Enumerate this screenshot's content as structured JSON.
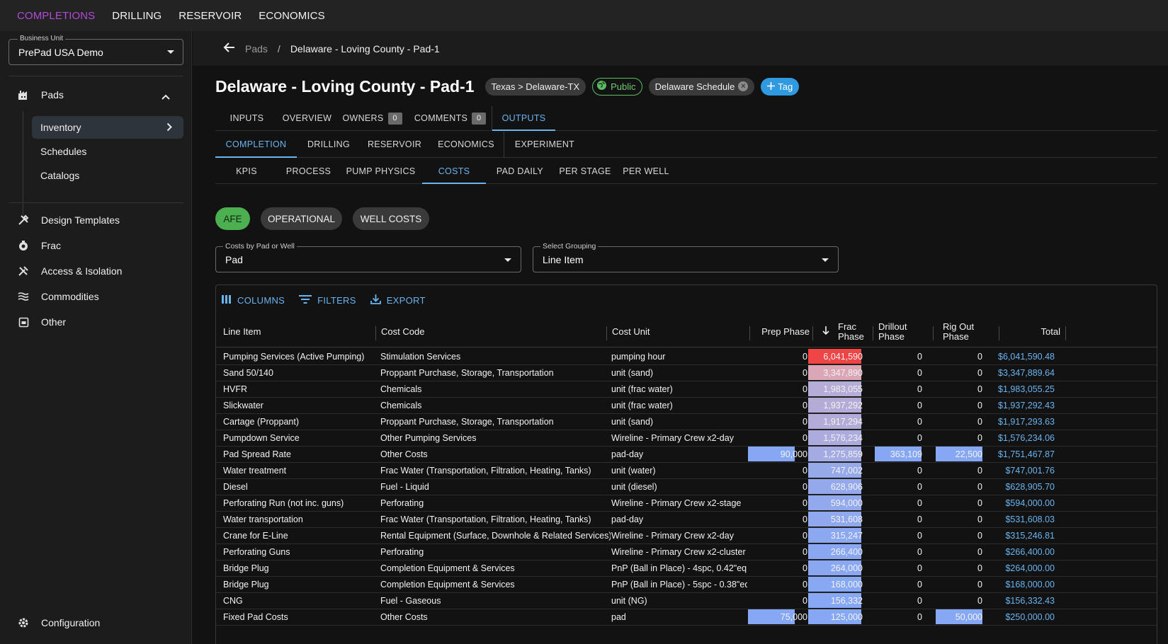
{
  "topnav": [
    "COMPLETIONS",
    "DRILLING",
    "RESERVOIR",
    "ECONOMICS"
  ],
  "sidebar": {
    "business_unit_label": "Business Unit",
    "business_unit_value": "PrePad USA Demo",
    "pads_label": "Pads",
    "pads_children": [
      "Inventory",
      "Schedules",
      "Catalogs"
    ],
    "items": [
      "Design Templates",
      "Frac",
      "Access & Isolation",
      "Commodities",
      "Other"
    ],
    "configuration": "Configuration"
  },
  "breadcrumb": {
    "parent": "Pads",
    "separator": "/",
    "current": "Delaware - Loving County - Pad-1"
  },
  "title": "Delaware - Loving County - Pad-1",
  "chips": {
    "location": "Texas > Delaware-TX",
    "visibility": "Public",
    "schedule": "Delaware Schedule",
    "add_tag": "Tag"
  },
  "tabs_main": [
    {
      "label": "INPUTS"
    },
    {
      "label": "OVERVIEW"
    },
    {
      "label": "OWNERS",
      "count": "0"
    },
    {
      "label": "COMMENTS",
      "count": "0"
    },
    {
      "label": "OUTPUTS"
    }
  ],
  "tabs_domain": [
    "COMPLETION",
    "DRILLING",
    "RESERVOIR",
    "ECONOMICS",
    "EXPERIMENT"
  ],
  "tabs_completion": [
    "KPIS",
    "PROCESS",
    "PUMP PHYSICS",
    "COSTS",
    "PAD DAILY",
    "PER STAGE",
    "PER WELL"
  ],
  "cost_views": [
    "AFE",
    "OPERATIONAL",
    "WELL COSTS"
  ],
  "selects": {
    "costs_by": {
      "label": "Costs by Pad or Well",
      "value": "Pad"
    },
    "grouping": {
      "label": "Select Grouping",
      "value": "Line Item"
    }
  },
  "toolbar": {
    "columns": "COLUMNS",
    "filters": "FILTERS",
    "export": "EXPORT"
  },
  "table": {
    "headers": {
      "line_item": "Line Item",
      "cost_code": "Cost Code",
      "cost_unit": "Cost Unit",
      "prep": "Prep Phase",
      "frac_1": "Frac",
      "frac_2": "Phase",
      "drillout_1": "Drillout",
      "drillout_2": "Phase",
      "rigout_1": "Rig Out",
      "rigout_2": "Phase",
      "total": "Total"
    },
    "sort_column": "Frac Phase",
    "sort_direction": "descending",
    "colors": {
      "high": "#ef4545",
      "mid": "#d9b0c0",
      "low": "#86a8f4"
    },
    "rows": [
      {
        "line_item": "Pumping Services (Active Pumping)",
        "cost_code": "Stimulation Services",
        "cost_unit": "pumping hour",
        "prep": "0",
        "frac": "6,041,590",
        "drillout": "0",
        "rigout": "0",
        "total": "$6,041,590.48"
      },
      {
        "line_item": "Sand 50/140",
        "cost_code": "Proppant Purchase, Storage, Transportation",
        "cost_unit": "unit (sand)",
        "prep": "0",
        "frac": "3,347,890",
        "drillout": "0",
        "rigout": "0",
        "total": "$3,347,889.64"
      },
      {
        "line_item": "HVFR",
        "cost_code": "Chemicals",
        "cost_unit": "unit (frac water)",
        "prep": "0",
        "frac": "1,983,055",
        "drillout": "0",
        "rigout": "0",
        "total": "$1,983,055.25"
      },
      {
        "line_item": "Slickwater",
        "cost_code": "Chemicals",
        "cost_unit": "unit (frac water)",
        "prep": "0",
        "frac": "1,937,292",
        "drillout": "0",
        "rigout": "0",
        "total": "$1,937,292.43"
      },
      {
        "line_item": "Cartage (Proppant)",
        "cost_code": "Proppant Purchase, Storage, Transportation",
        "cost_unit": "unit (sand)",
        "prep": "0",
        "frac": "1,917,294",
        "drillout": "0",
        "rigout": "0",
        "total": "$1,917,293.63"
      },
      {
        "line_item": "Pumpdown Service",
        "cost_code": "Other Pumping Services",
        "cost_unit": "Wireline - Primary Crew x2-day",
        "prep": "0",
        "frac": "1,576,234",
        "drillout": "0",
        "rigout": "0",
        "total": "$1,576,234.06"
      },
      {
        "line_item": "Pad Spread Rate",
        "cost_code": "Other Costs",
        "cost_unit": "pad-day",
        "prep": "90,000",
        "frac": "1,275,859",
        "drillout": "363,109",
        "rigout": "22,500",
        "total": "$1,751,467.87"
      },
      {
        "line_item": "Water treatment",
        "cost_code": "Frac Water (Transportation, Filtration, Heating, Tanks)",
        "cost_unit": "unit (water)",
        "prep": "0",
        "frac": "747,002",
        "drillout": "0",
        "rigout": "0",
        "total": "$747,001.76"
      },
      {
        "line_item": "Diesel",
        "cost_code": "Fuel - Liquid",
        "cost_unit": "unit (diesel)",
        "prep": "0",
        "frac": "628,906",
        "drillout": "0",
        "rigout": "0",
        "total": "$628,905.70"
      },
      {
        "line_item": "Perforating Run (not inc. guns)",
        "cost_code": "Perforating",
        "cost_unit": "Wireline - Primary Crew x2-stage",
        "prep": "0",
        "frac": "594,000",
        "drillout": "0",
        "rigout": "0",
        "total": "$594,000.00"
      },
      {
        "line_item": "Water transportation",
        "cost_code": "Frac Water (Transportation, Filtration, Heating, Tanks)",
        "cost_unit": "pad-day",
        "prep": "0",
        "frac": "531,608",
        "drillout": "0",
        "rigout": "0",
        "total": "$531,608.03"
      },
      {
        "line_item": "Crane for E-Line",
        "cost_code": "Rental Equipment (Surface, Downhole & Related Services)",
        "cost_unit": "Wireline - Primary Crew x2-day",
        "prep": "0",
        "frac": "315,247",
        "drillout": "0",
        "rigout": "0",
        "total": "$315,246.81"
      },
      {
        "line_item": "Perforating Guns",
        "cost_code": "Perforating",
        "cost_unit": "Wireline - Primary Crew x2-cluster",
        "prep": "0",
        "frac": "266,400",
        "drillout": "0",
        "rigout": "0",
        "total": "$266,400.00"
      },
      {
        "line_item": "Bridge Plug",
        "cost_code": "Completion Equipment & Services",
        "cost_unit": "PnP (Ball in Place) - 4spc, 0.42\"eq -",
        "prep": "0",
        "frac": "264,000",
        "drillout": "0",
        "rigout": "0",
        "total": "$264,000.00"
      },
      {
        "line_item": "Bridge Plug",
        "cost_code": "Completion Equipment & Services",
        "cost_unit": "PnP (Ball in Place) - 5spc - 0.38\"eq -",
        "prep": "0",
        "frac": "168,000",
        "drillout": "0",
        "rigout": "0",
        "total": "$168,000.00"
      },
      {
        "line_item": "CNG",
        "cost_code": "Fuel - Gaseous",
        "cost_unit": "unit (NG)",
        "prep": "0",
        "frac": "156,332",
        "drillout": "0",
        "rigout": "0",
        "total": "$156,332.43"
      },
      {
        "line_item": "Fixed Pad Costs",
        "cost_code": "Other Costs",
        "cost_unit": "pad",
        "prep": "75,000",
        "frac": "125,000",
        "drillout": "0",
        "rigout": "50,000",
        "total": "$250,000.00"
      }
    ]
  }
}
